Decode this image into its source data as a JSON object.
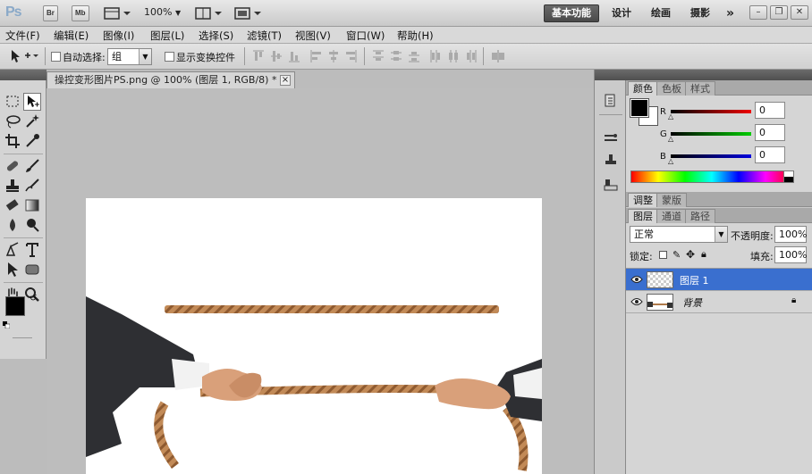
{
  "app": {
    "logo": "Ps",
    "buttons": [
      "Br",
      "Mb"
    ],
    "zoom": "100%",
    "workspaces": [
      "基本功能",
      "设计",
      "绘画",
      "摄影"
    ],
    "overflow": "»"
  },
  "menu": [
    "文件(F)",
    "编辑(E)",
    "图像(I)",
    "图层(L)",
    "选择(S)",
    "滤镜(T)",
    "视图(V)",
    "窗口(W)",
    "帮助(H)"
  ],
  "options": {
    "auto_select_label": "自动选择:",
    "auto_select_value": "组",
    "show_transform_label": "显示变换控件"
  },
  "document": {
    "tab_title": "操控变形图片PS.png @ 100% (图层 1, RGB/8) *",
    "close": "×"
  },
  "color_panel": {
    "tabs": [
      "颜色",
      "色板",
      "样式"
    ],
    "r_label": "R",
    "g_label": "G",
    "b_label": "B",
    "r": "0",
    "g": "0",
    "b": "0",
    "foreground": "#000000",
    "background": "#ffffff"
  },
  "adjust_panel": {
    "tabs": [
      "调整",
      "蒙版"
    ]
  },
  "layers_panel": {
    "tabs": [
      "图层",
      "通道",
      "路径"
    ],
    "blend_mode": "正常",
    "opacity_label": "不透明度:",
    "opacity": "100%",
    "lock_label": "锁定:",
    "fill_label": "填充:",
    "fill": "100%",
    "layers": [
      {
        "name": "图层 1",
        "selected": true
      },
      {
        "name": "背景",
        "selected": false,
        "locked": true
      }
    ]
  },
  "colors": {
    "selected_layer": "#3a6fcf",
    "rope": "#b07a4a"
  }
}
